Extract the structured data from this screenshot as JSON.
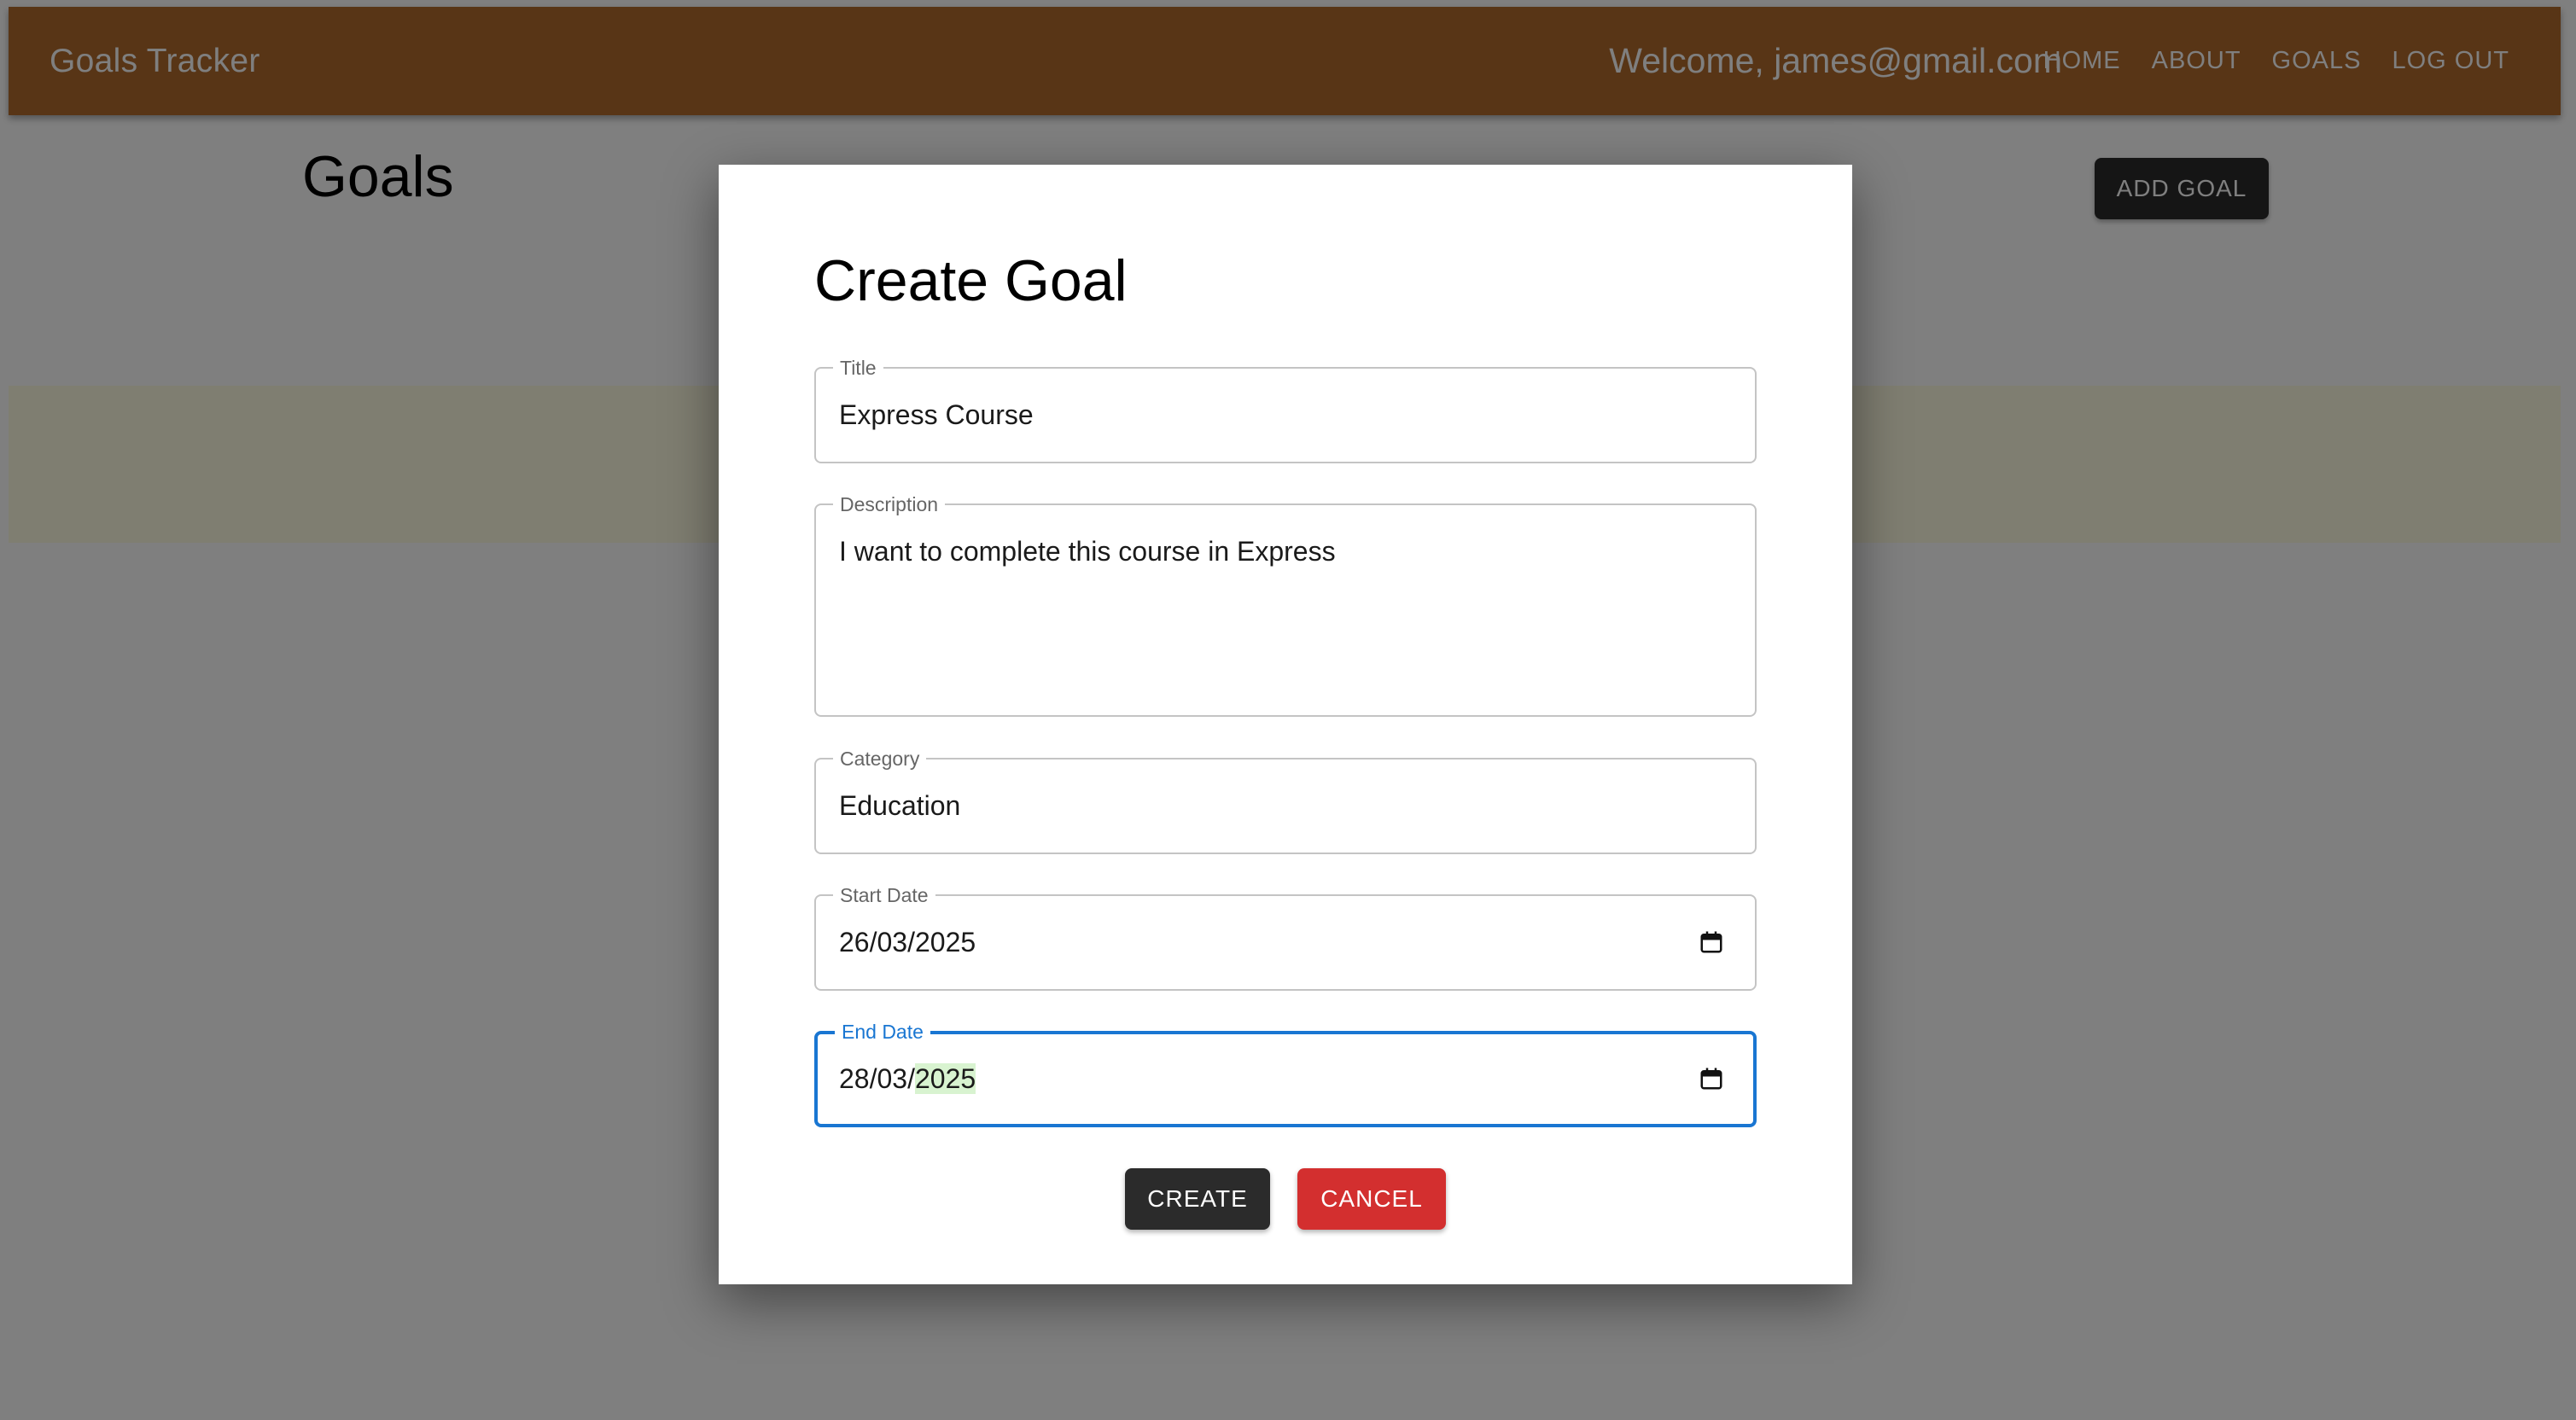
{
  "appbar": {
    "brand": "Goals Tracker",
    "welcome": "Welcome, james@gmail.com",
    "nav": [
      "HOME",
      "ABOUT",
      "GOALS",
      "LOG OUT"
    ],
    "color": "#b06b2d"
  },
  "page": {
    "title": "Goals",
    "add_goal_label": "ADD GOAL"
  },
  "dialog": {
    "title": "Create Goal",
    "fields": {
      "title": {
        "label": "Title",
        "value": "Express Course"
      },
      "description": {
        "label": "Description",
        "value": "I want to complete this course in Express"
      },
      "category": {
        "label": "Category",
        "value": "Education"
      },
      "start_date": {
        "label": "Start Date",
        "value": "26/03/2025"
      },
      "end_date": {
        "label": "End Date",
        "day_month": "28/03/",
        "year": "2025",
        "focused": true
      }
    },
    "create_label": "CREATE",
    "cancel_label": "CANCEL"
  },
  "colors": {
    "focus": "#1976d2",
    "cancel": "#d32f2f",
    "dark_button": "#2b2b2b"
  },
  "icons": {
    "date_picker": "calendar-icon"
  }
}
